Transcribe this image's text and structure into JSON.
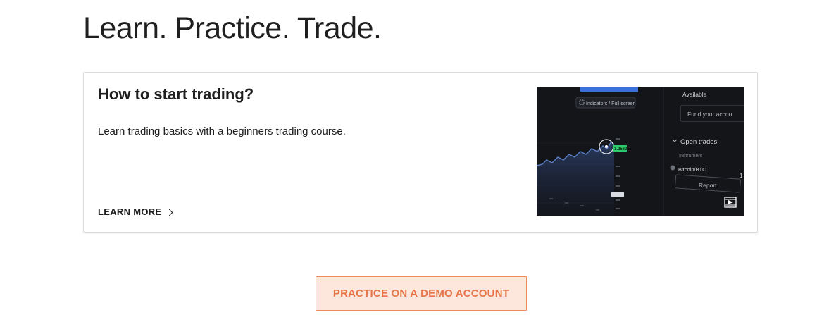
{
  "header": {
    "title": "Learn. Practice. Trade."
  },
  "course_card": {
    "title": "How to start trading?",
    "description": "Learn trading basics with a beginners trading course.",
    "link_label": "LEARN MORE",
    "thumbnail": {
      "indicators_label": "Indicators / Full screen",
      "available_label": "Available",
      "fund_placeholder": "Fund your accou",
      "open_trades_label": "Open trades",
      "instrument_label": "Instrument",
      "instrument_value": "Bitcoin/BTC",
      "report_label": "Report",
      "price_badge": "1.2562",
      "play_icon": "video-play-icon"
    }
  },
  "cta": {
    "label": "PRACTICE ON A DEMO ACCOUNT"
  },
  "colors": {
    "accent": "#e8754a",
    "cta_bg": "#fde6dc",
    "badge_green": "#2ecc71",
    "chart_line": "#5b7fc7"
  }
}
